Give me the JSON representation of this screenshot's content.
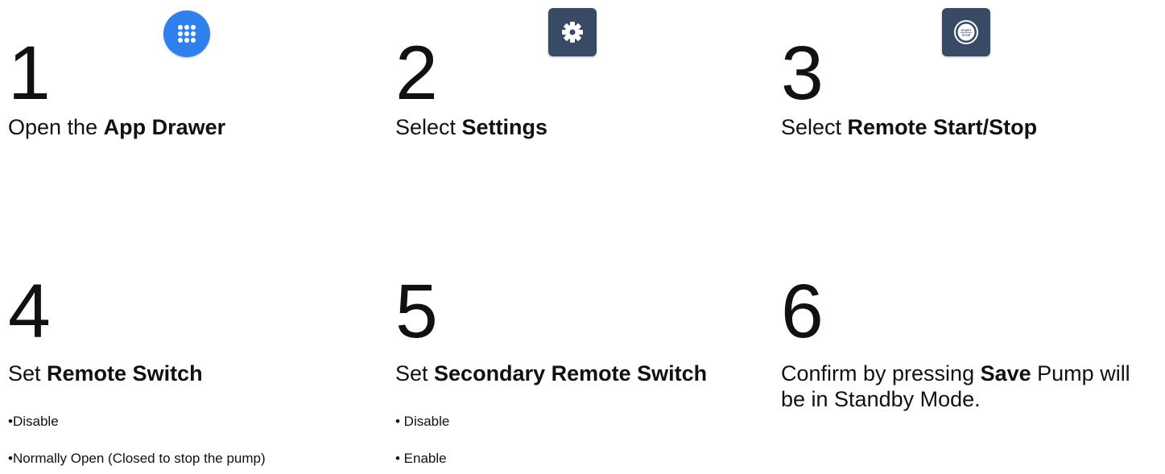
{
  "steps": [
    {
      "number": "1",
      "prefix": "Open the ",
      "bold": "App Drawer",
      "suffix": "",
      "icon": "app-drawer-icon"
    },
    {
      "number": "2",
      "prefix": "Select ",
      "bold": "Settings",
      "suffix": "",
      "icon": "gear-icon"
    },
    {
      "number": "3",
      "prefix": "Select ",
      "bold": "Remote Start/Stop",
      "suffix": "",
      "icon": "start-stop-icon",
      "icon_text_top": "START",
      "icon_text_bottom": "STOP"
    },
    {
      "number": "4",
      "prefix": "Set ",
      "bold": "Remote Switch",
      "suffix": "",
      "bullets": [
        "•Disable",
        "•Normally Open (Closed to stop the pump)"
      ]
    },
    {
      "number": "5",
      "prefix": "Set ",
      "bold": "Secondary Remote Switch",
      "suffix": "",
      "bullets": [
        "• Disable",
        "• Enable"
      ]
    },
    {
      "number": "6",
      "prefix": "Confirm by pressing ",
      "bold": "Save",
      "suffix": " Pump will be in Standby Mode."
    }
  ],
  "colors": {
    "drawer_blue": "#2f80ed",
    "tile_navy": "#384a66",
    "text": "#111111"
  }
}
